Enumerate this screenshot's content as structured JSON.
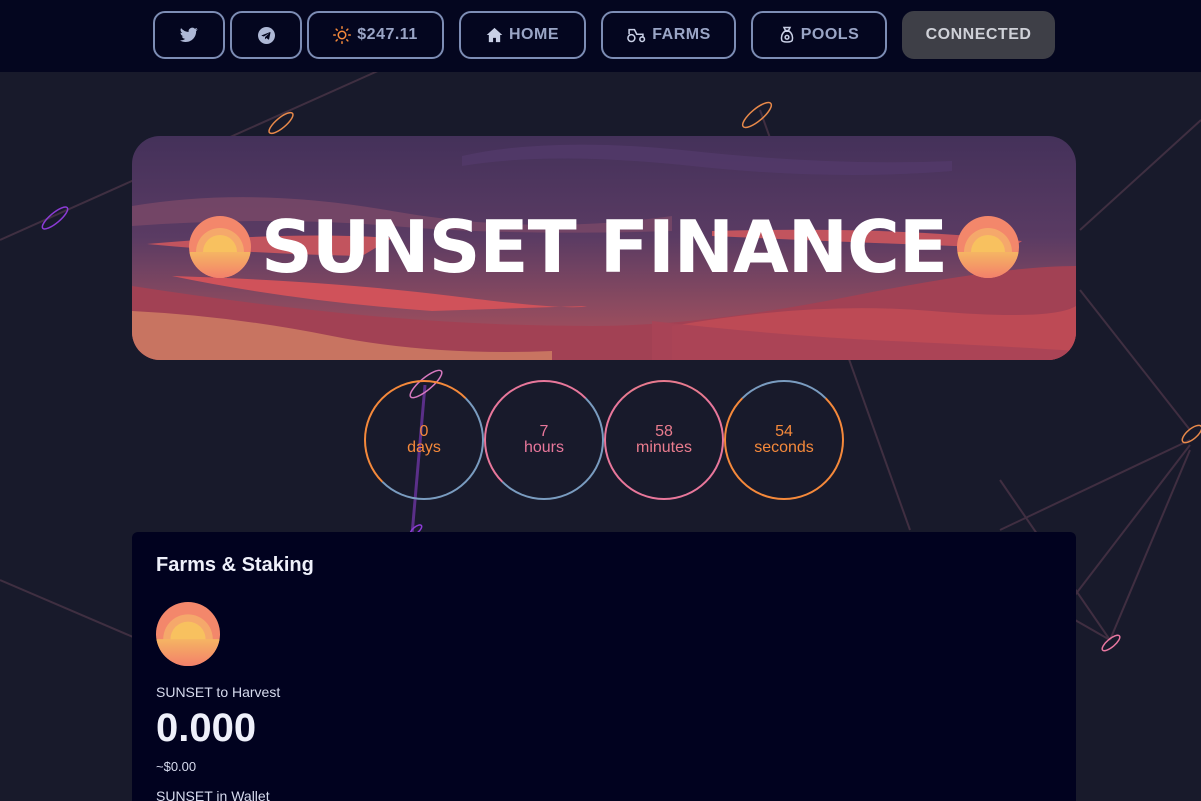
{
  "nav": {
    "twitter_icon": "twitter-icon",
    "telegram_icon": "telegram-icon",
    "price": "$247.11",
    "home": "HOME",
    "farms": "FARMS",
    "pools": "POOLS",
    "connect": "CONNECTED"
  },
  "banner": {
    "title": "SUNSET FINANCE"
  },
  "countdown": [
    {
      "value": "0",
      "unit": "days"
    },
    {
      "value": "7",
      "unit": "hours"
    },
    {
      "value": "58",
      "unit": "minutes"
    },
    {
      "value": "54",
      "unit": "seconds"
    }
  ],
  "farms": {
    "title": "Farms & Staking",
    "harvest_label": "SUNSET to Harvest",
    "harvest_value": "0.000",
    "harvest_usd": "~$0.00",
    "wallet_label": "SUNSET in Wallet"
  },
  "colors": {
    "accent_orange": "#f5893b",
    "accent_pink": "#e8779b",
    "accent_blue": "#7a9cc0",
    "card_bg": "#01021f",
    "page_bg": "#181a2b"
  }
}
